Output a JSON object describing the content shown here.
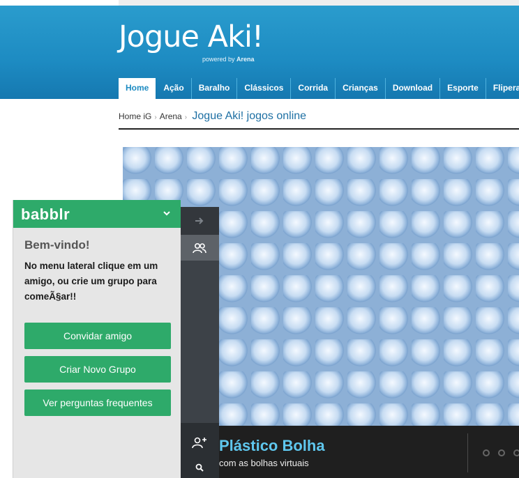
{
  "site": {
    "title": "Jogue Aki!",
    "powered_prefix": "powered by",
    "powered_brand": "Arena"
  },
  "nav": {
    "items": [
      "Home",
      "Ação",
      "Baralho",
      "Clássicos",
      "Corrida",
      "Crianças",
      "Download",
      "Esporte",
      "Fliperama"
    ]
  },
  "breadcrumb": {
    "home": "Home iG",
    "section": "Arena",
    "current": "Jogue Aki! jogos online"
  },
  "game": {
    "title": "Plástico Bolha",
    "subtitle": "com as bolhas virtuais"
  },
  "sidebar": {
    "icons": [
      "arrow-right-icon",
      "people-icon",
      "add-user-icon",
      "search-icon"
    ]
  },
  "babblr": {
    "brand": "babblr",
    "welcome": "Bem-vindo!",
    "message": "No menu lateral clique em um amigo, ou crie um grupo para comeÃ§ar!!",
    "buttons": {
      "invite": "Convidar amigo",
      "new_group": "Criar Novo Grupo",
      "faq": "Ver perguntas frequentes"
    }
  },
  "colors": {
    "header_blue": "#1d8bc2",
    "babblr_green": "#2eaa6a",
    "game_title": "#5fc7ee"
  }
}
